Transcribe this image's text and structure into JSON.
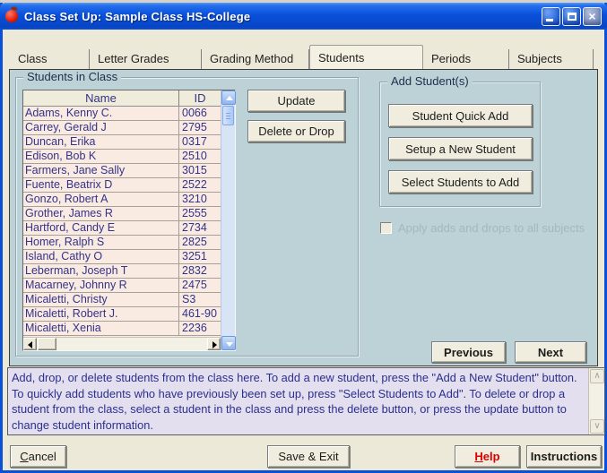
{
  "window": {
    "title": "Class Set Up: Sample Class HS-College"
  },
  "tabs": [
    {
      "label": "Class",
      "active": false
    },
    {
      "label": "Letter Grades",
      "active": false
    },
    {
      "label": "Grading Method",
      "active": false
    },
    {
      "label": "Students",
      "active": true
    },
    {
      "label": "Periods",
      "active": false
    },
    {
      "label": "Subjects",
      "active": false
    }
  ],
  "students_group": {
    "title": "Students in Class",
    "columns": [
      "Name",
      "ID"
    ],
    "rows": [
      {
        "name": "Adams, Kenny C.",
        "id": "0066"
      },
      {
        "name": "Carrey, Gerald J",
        "id": "2795"
      },
      {
        "name": "Duncan, Erika",
        "id": "0317"
      },
      {
        "name": "Edison, Bob K",
        "id": "2510"
      },
      {
        "name": "Farmers, Jane Sally",
        "id": "3015"
      },
      {
        "name": "Fuente, Beatrix D",
        "id": "2522"
      },
      {
        "name": "Gonzo, Robert A",
        "id": "3210"
      },
      {
        "name": "Grother, James R",
        "id": "2555"
      },
      {
        "name": "Hartford, Candy E",
        "id": "2734"
      },
      {
        "name": "Homer, Ralph S",
        "id": "2825"
      },
      {
        "name": "Island, Cathy O",
        "id": "3251"
      },
      {
        "name": "Leberman, Joseph T",
        "id": "2832"
      },
      {
        "name": "Macarney, Johnny R",
        "id": "2475"
      },
      {
        "name": "Micaletti, Christy",
        "id": "S3"
      },
      {
        "name": "Micaletti, Robert J.",
        "id": "461-90"
      },
      {
        "name": "Micaletti, Xenia",
        "id": "2236"
      }
    ],
    "update_label": "Update",
    "delete_label": "Delete or Drop"
  },
  "add_group": {
    "title": "Add Student(s)",
    "buttons": [
      {
        "label": "Student Quick Add",
        "name": "student-quick-add-button"
      },
      {
        "label": "Setup a New Student",
        "name": "setup-new-student-button"
      },
      {
        "label": "Select Students to Add",
        "name": "select-students-to-add-button"
      }
    ],
    "checkbox_label": "Apply adds and drops to all subjects",
    "checkbox_checked": false,
    "checkbox_enabled": false
  },
  "nav": {
    "previous": "Previous",
    "next": "Next"
  },
  "instructions_text": "Add, drop, or delete students from the class here. To add a new student, press the \"Add a New Student\" button.  To quickly add students who have previously been set up, press \"Select Students to Add\". To delete or drop a student from the class, select a student in the class and press the delete button, or press the update button to change student information.",
  "footer": {
    "cancel": "Cancel",
    "save_exit": "Save & Exit",
    "help": "Help",
    "instructions": "Instructions"
  },
  "colors": {
    "titlebar_blue": "#0A50DC",
    "window_border": "#0B50D8",
    "dialog_face": "#ECE9D8",
    "panel_bluegray": "#BDD2D6",
    "list_row_pink": "#F9EAE2",
    "text_navy": "#333388",
    "instructions_bg": "#E3DFEF",
    "help_red": "#DE0000",
    "button_face": "#F1EDDE"
  }
}
